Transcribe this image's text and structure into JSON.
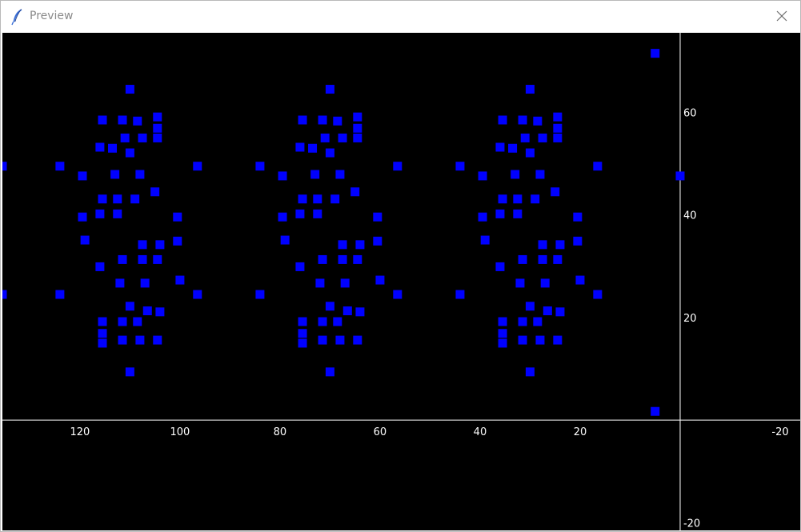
{
  "window": {
    "title": "Preview",
    "icons": {
      "app": "feather-icon",
      "close": "close-icon"
    }
  },
  "chart_data": {
    "type": "scatter",
    "title": "",
    "xlabel": "",
    "ylabel": "",
    "xlim": [
      135.5,
      -24
    ],
    "ylim": [
      -21.5,
      75.5
    ],
    "grid": false,
    "x_ticks": [
      120,
      100,
      80,
      60,
      40,
      20,
      -20
    ],
    "y_ticks": [
      60,
      40,
      20,
      -20
    ],
    "colors": {
      "background": "#000000",
      "axes": "#ffffff",
      "ticks": "#ffffff",
      "marker": "#0000ff"
    },
    "series": [
      {
        "marker": "square",
        "points": [
          [
            110.0,
            64.5
          ],
          [
            115.5,
            58.5
          ],
          [
            111.5,
            58.5
          ],
          [
            108.5,
            58.3
          ],
          [
            104.5,
            59.1
          ],
          [
            104.5,
            56.9
          ],
          [
            111.0,
            55.0
          ],
          [
            107.5,
            55.0
          ],
          [
            104.5,
            55.0
          ],
          [
            116.0,
            53.2
          ],
          [
            113.5,
            53.0
          ],
          [
            110.0,
            52.1
          ],
          [
            135.5,
            49.5
          ],
          [
            124.0,
            49.5
          ],
          [
            96.5,
            49.5
          ],
          [
            119.5,
            47.6
          ],
          [
            113.0,
            47.9
          ],
          [
            108.0,
            47.9
          ],
          [
            105.0,
            44.5
          ],
          [
            115.5,
            43.1
          ],
          [
            112.5,
            43.1
          ],
          [
            109.0,
            43.1
          ],
          [
            116.0,
            40.2
          ],
          [
            112.5,
            40.2
          ],
          [
            119.5,
            39.6
          ],
          [
            100.5,
            39.6
          ],
          [
            119.0,
            35.1
          ],
          [
            107.5,
            34.2
          ],
          [
            104.0,
            34.2
          ],
          [
            100.5,
            34.9
          ],
          [
            111.5,
            31.3
          ],
          [
            107.5,
            31.3
          ],
          [
            104.5,
            31.3
          ],
          [
            116.0,
            29.9
          ],
          [
            112.0,
            26.7
          ],
          [
            107.0,
            26.7
          ],
          [
            100.0,
            27.3
          ],
          [
            135.5,
            24.5
          ],
          [
            124.0,
            24.5
          ],
          [
            96.5,
            24.5
          ],
          [
            110.0,
            22.2
          ],
          [
            106.5,
            21.3
          ],
          [
            104.0,
            21.1
          ],
          [
            115.5,
            19.2
          ],
          [
            111.5,
            19.2
          ],
          [
            108.5,
            19.2
          ],
          [
            115.5,
            16.9
          ],
          [
            111.5,
            15.6
          ],
          [
            108.0,
            15.6
          ],
          [
            104.5,
            15.6
          ],
          [
            115.5,
            15.0
          ],
          [
            110.0,
            9.4
          ],
          [
            70.0,
            64.5
          ],
          [
            75.5,
            58.5
          ],
          [
            71.5,
            58.5
          ],
          [
            68.5,
            58.3
          ],
          [
            64.5,
            59.1
          ],
          [
            64.5,
            56.9
          ],
          [
            71.0,
            55.0
          ],
          [
            67.5,
            55.0
          ],
          [
            64.5,
            55.0
          ],
          [
            76.0,
            53.2
          ],
          [
            73.5,
            53.0
          ],
          [
            70.0,
            52.1
          ],
          [
            84.0,
            49.5
          ],
          [
            56.5,
            49.5
          ],
          [
            79.5,
            47.6
          ],
          [
            73.0,
            47.9
          ],
          [
            68.0,
            47.9
          ],
          [
            65.0,
            44.5
          ],
          [
            75.5,
            43.1
          ],
          [
            72.5,
            43.1
          ],
          [
            69.0,
            43.1
          ],
          [
            76.0,
            40.2
          ],
          [
            72.5,
            40.2
          ],
          [
            79.5,
            39.6
          ],
          [
            60.5,
            39.6
          ],
          [
            79.0,
            35.1
          ],
          [
            67.5,
            34.2
          ],
          [
            64.0,
            34.2
          ],
          [
            60.5,
            34.9
          ],
          [
            71.5,
            31.3
          ],
          [
            67.5,
            31.3
          ],
          [
            64.5,
            31.3
          ],
          [
            76.0,
            29.9
          ],
          [
            72.0,
            26.7
          ],
          [
            67.0,
            26.7
          ],
          [
            60.0,
            27.3
          ],
          [
            84.0,
            24.5
          ],
          [
            56.5,
            24.5
          ],
          [
            70.0,
            22.2
          ],
          [
            66.5,
            21.3
          ],
          [
            64.0,
            21.1
          ],
          [
            75.5,
            19.2
          ],
          [
            71.5,
            19.2
          ],
          [
            68.5,
            19.2
          ],
          [
            75.5,
            16.9
          ],
          [
            71.5,
            15.6
          ],
          [
            68.0,
            15.6
          ],
          [
            64.5,
            15.6
          ],
          [
            75.5,
            15.0
          ],
          [
            70.0,
            9.4
          ],
          [
            30.0,
            64.5
          ],
          [
            35.5,
            58.5
          ],
          [
            31.5,
            58.5
          ],
          [
            28.5,
            58.3
          ],
          [
            24.5,
            59.1
          ],
          [
            24.5,
            56.9
          ],
          [
            31.0,
            55.0
          ],
          [
            27.5,
            55.0
          ],
          [
            24.5,
            55.0
          ],
          [
            36.0,
            53.2
          ],
          [
            33.5,
            53.0
          ],
          [
            30.0,
            52.1
          ],
          [
            44.0,
            49.5
          ],
          [
            16.5,
            49.5
          ],
          [
            39.5,
            47.6
          ],
          [
            33.0,
            47.9
          ],
          [
            28.0,
            47.9
          ],
          [
            25.0,
            44.5
          ],
          [
            35.5,
            43.1
          ],
          [
            32.5,
            43.1
          ],
          [
            29.0,
            43.1
          ],
          [
            36.0,
            40.2
          ],
          [
            32.5,
            40.2
          ],
          [
            39.5,
            39.6
          ],
          [
            20.5,
            39.6
          ],
          [
            39.0,
            35.1
          ],
          [
            27.5,
            34.2
          ],
          [
            24.0,
            34.2
          ],
          [
            20.5,
            34.9
          ],
          [
            31.5,
            31.3
          ],
          [
            27.5,
            31.3
          ],
          [
            24.5,
            31.3
          ],
          [
            36.0,
            29.9
          ],
          [
            32.0,
            26.7
          ],
          [
            27.0,
            26.7
          ],
          [
            20.0,
            27.3
          ],
          [
            44.0,
            24.5
          ],
          [
            16.5,
            24.5
          ],
          [
            30.0,
            22.2
          ],
          [
            26.5,
            21.3
          ],
          [
            24.0,
            21.1
          ],
          [
            35.5,
            19.2
          ],
          [
            31.5,
            19.2
          ],
          [
            28.5,
            19.2
          ],
          [
            35.5,
            16.9
          ],
          [
            31.5,
            15.6
          ],
          [
            28.0,
            15.6
          ],
          [
            24.5,
            15.6
          ],
          [
            35.5,
            15.0
          ],
          [
            30.0,
            9.4
          ],
          [
            5.0,
            71.5
          ],
          [
            0.0,
            47.6
          ],
          [
            5.0,
            1.7
          ]
        ]
      }
    ]
  }
}
